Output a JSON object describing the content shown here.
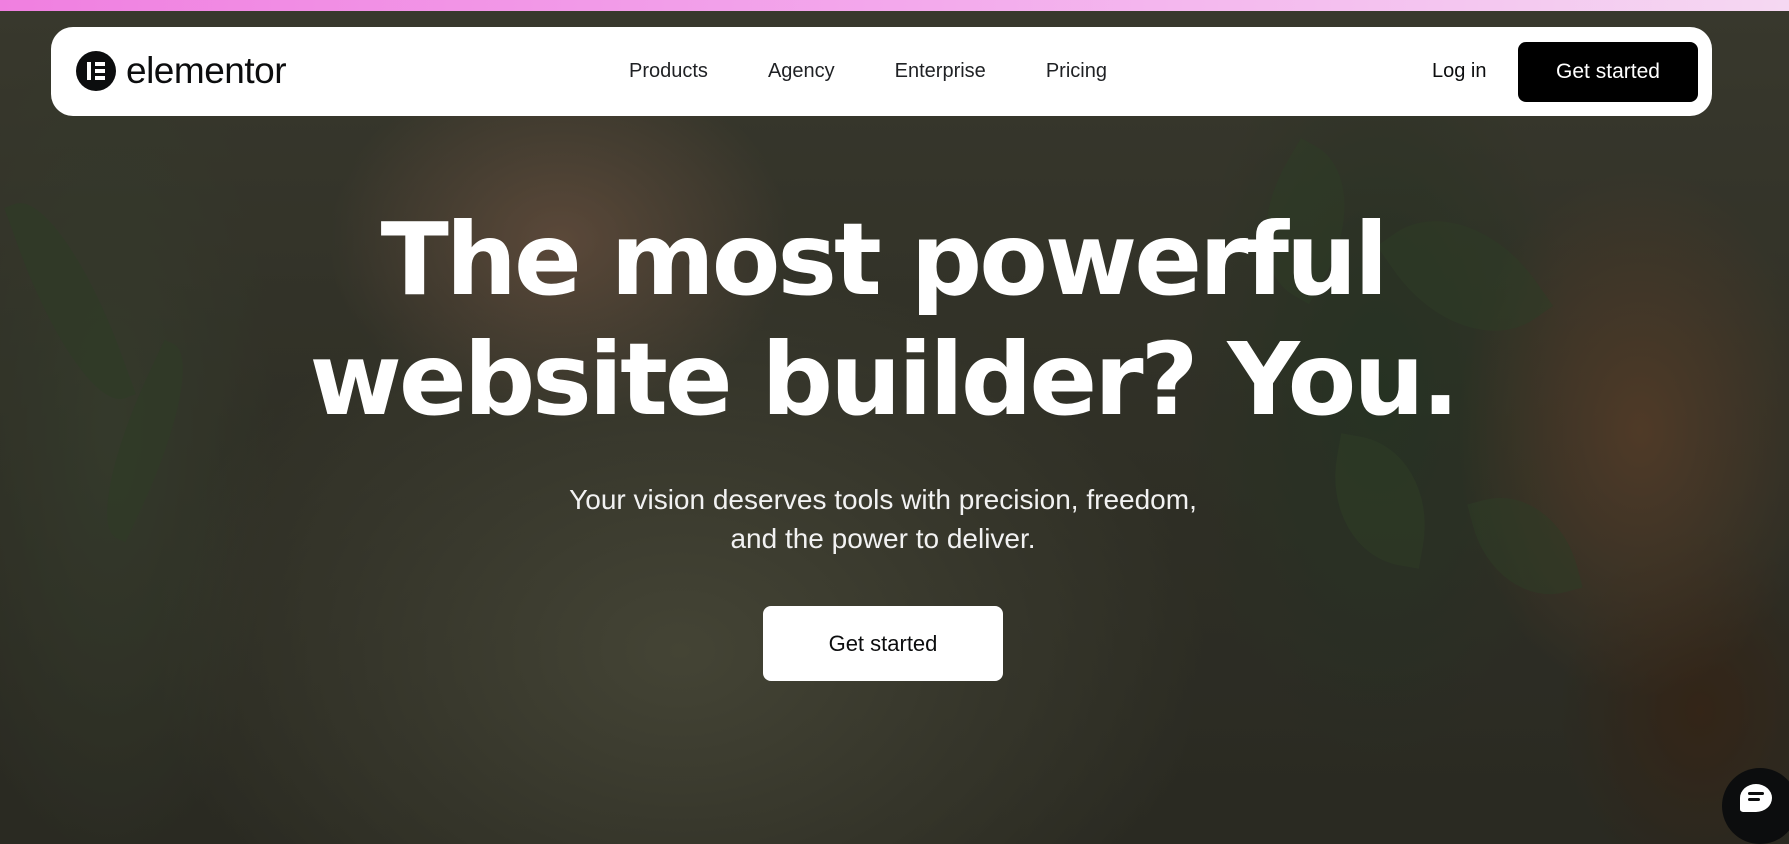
{
  "colors": {
    "top_strip": "#f07fe0",
    "nav_background": "#ffffff",
    "primary_button": "#000000",
    "hero_text": "#ffffff"
  },
  "nav": {
    "logo_text": "elementor",
    "logo_icon": "elementor-logo-icon",
    "links": [
      {
        "label": "Products"
      },
      {
        "label": "Agency"
      },
      {
        "label": "Enterprise"
      },
      {
        "label": "Pricing"
      }
    ],
    "login_label": "Log in",
    "cta_label": "Get started"
  },
  "hero": {
    "title_lines": [
      "The most powerful",
      "website builder? You."
    ],
    "subtitle_lines": [
      "Your vision deserves tools with precision, freedom,",
      "and the power to deliver."
    ],
    "cta_label": "Get started"
  },
  "chat": {
    "icon": "chat-icon"
  }
}
